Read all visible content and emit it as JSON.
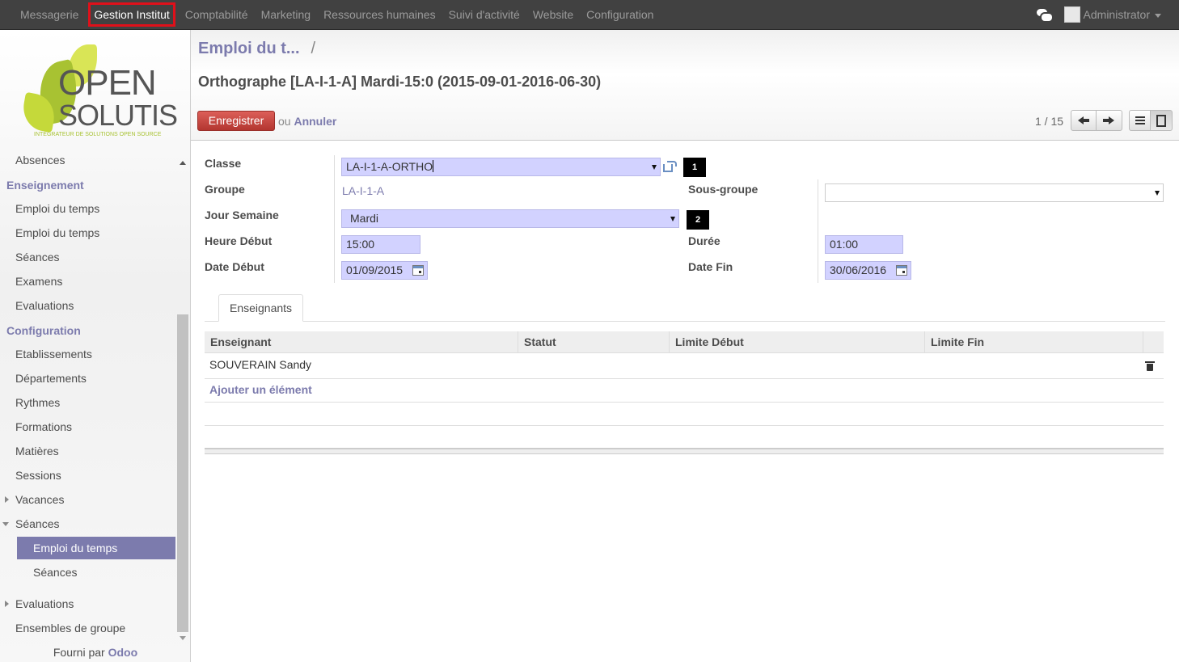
{
  "topmenu": {
    "items": [
      "Messagerie",
      "Gestion Institut",
      "Comptabilité",
      "Marketing",
      "Ressources humaines",
      "Suivi d'activité",
      "Website",
      "Configuration"
    ],
    "active_index": 1,
    "user": "Administrator"
  },
  "logo": {
    "line1": "OPEN",
    "line2": "SOLUTIS",
    "tagline": "INTEGRATEUR DE SOLUTIONS OPEN SOURCE"
  },
  "sidebar": {
    "absences": "Absences",
    "section1": {
      "title": "Enseignement",
      "items": [
        "Emploi du temps",
        "Emploi du temps",
        "Séances",
        "Examens",
        "Evaluations"
      ]
    },
    "section2": {
      "title": "Configuration",
      "items": [
        "Etablissements",
        "Départements",
        "Rythmes",
        "Formations",
        "Matières",
        "Sessions"
      ]
    },
    "vacances": "Vacances",
    "seances_group": "Séances",
    "seances_children": [
      "Emploi du temps",
      "Séances"
    ],
    "evaluations": "Evaluations",
    "ensembles": "Ensembles de groupe",
    "footer_prefix": "Fourni par ",
    "footer_brand": "Odoo"
  },
  "header": {
    "breadcrumb": "Emploi du t...",
    "breadcrumb_sep": "/",
    "title": "Orthographe [LA-I-1-A] Mardi-15:0 (2015-09-01-2016-06-30)",
    "save_label": "Enregistrer",
    "or_label": "ou ",
    "cancel_label": "Annuler",
    "pager": "1 / 15"
  },
  "form": {
    "classe_label": "Classe",
    "classe_value": "LA-I-1-A-ORTHO",
    "groupe_label": "Groupe",
    "groupe_value": "LA-I-1-A",
    "sous_groupe_label": "Sous-groupe",
    "sous_groupe_value": "",
    "jour_label": "Jour Semaine",
    "jour_value": "Mardi",
    "heure_label": "Heure Début",
    "heure_value": "15:00",
    "duree_label": "Durée",
    "duree_value": "01:00",
    "date_debut_label": "Date Début",
    "date_debut_value": "01/09/2015",
    "date_fin_label": "Date Fin",
    "date_fin_value": "30/06/2016",
    "badge1": "1",
    "badge2": "2"
  },
  "tabs": [
    "Enseignants"
  ],
  "grid": {
    "columns": [
      "Enseignant",
      "Statut",
      "Limite Début",
      "Limite Fin"
    ],
    "rows": [
      [
        "SOUVERAIN Sandy",
        "",
        "",
        ""
      ]
    ],
    "add_label": "Ajouter un élément"
  }
}
